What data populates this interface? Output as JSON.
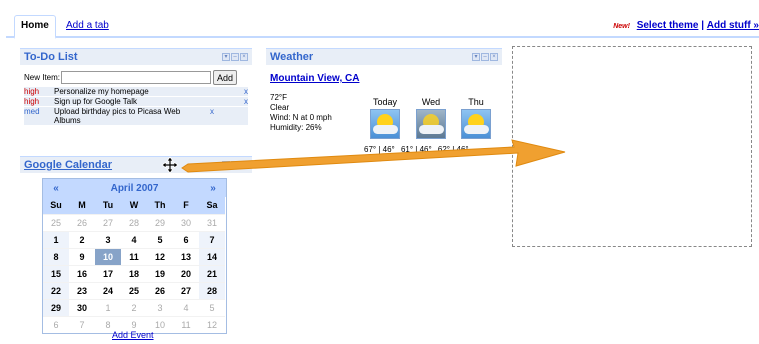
{
  "tabs": {
    "home": "Home",
    "add_tab": "Add a tab",
    "new_badge": "New!",
    "select_theme": "Select theme",
    "separator": "|",
    "add_stuff": "Add stuff »"
  },
  "todo": {
    "title": "To-Do List",
    "new_item_label": "New Item:",
    "new_item_value": "",
    "add_button": "Add",
    "items": [
      {
        "priority": "high",
        "text": "Personalize my homepage",
        "remove": "x"
      },
      {
        "priority": "high",
        "text": "Sign up for Google Talk",
        "remove": "x"
      },
      {
        "priority": "med",
        "text": "Upload birthday pics to Picasa Web Albums",
        "remove": "x"
      }
    ]
  },
  "weather": {
    "title": "Weather",
    "city": "Mountain View, CA",
    "temp": "72°F",
    "condition": "Clear",
    "wind": "Wind: N at 0 mph",
    "humidity": "Humidity: 26%",
    "forecast": [
      {
        "day": "Today",
        "temps": "67° | 46°",
        "icon": "sunny-icon"
      },
      {
        "day": "Wed",
        "temps": "61° | 46°",
        "icon": "partly-cloudy-icon"
      },
      {
        "day": "Thu",
        "temps": "62° | 46°",
        "icon": "sunny-icon"
      }
    ]
  },
  "calendar": {
    "title": "Google Calendar",
    "prev": "«",
    "next": "»",
    "month": "April 2007",
    "days_of_week": [
      "Su",
      "M",
      "Tu",
      "W",
      "Th",
      "F",
      "Sa"
    ],
    "weeks": [
      [
        "25",
        "26",
        "27",
        "28",
        "29",
        "30",
        "31"
      ],
      [
        "1",
        "2",
        "3",
        "4",
        "5",
        "6",
        "7"
      ],
      [
        "8",
        "9",
        "10",
        "11",
        "12",
        "13",
        "14"
      ],
      [
        "15",
        "16",
        "17",
        "18",
        "19",
        "20",
        "21"
      ],
      [
        "22",
        "23",
        "24",
        "25",
        "26",
        "27",
        "28"
      ],
      [
        "29",
        "30",
        "1",
        "2",
        "3",
        "4",
        "5"
      ],
      [
        "6",
        "7",
        "8",
        "9",
        "10",
        "11",
        "12"
      ]
    ],
    "today": "10",
    "add_event": "Add Event"
  },
  "gadget_controls": [
    "▾",
    "–",
    "×"
  ],
  "colors": {
    "header_bg": "#e8eef7",
    "title_blue": "#3366cc",
    "arrow_orange": "#f0a030"
  }
}
